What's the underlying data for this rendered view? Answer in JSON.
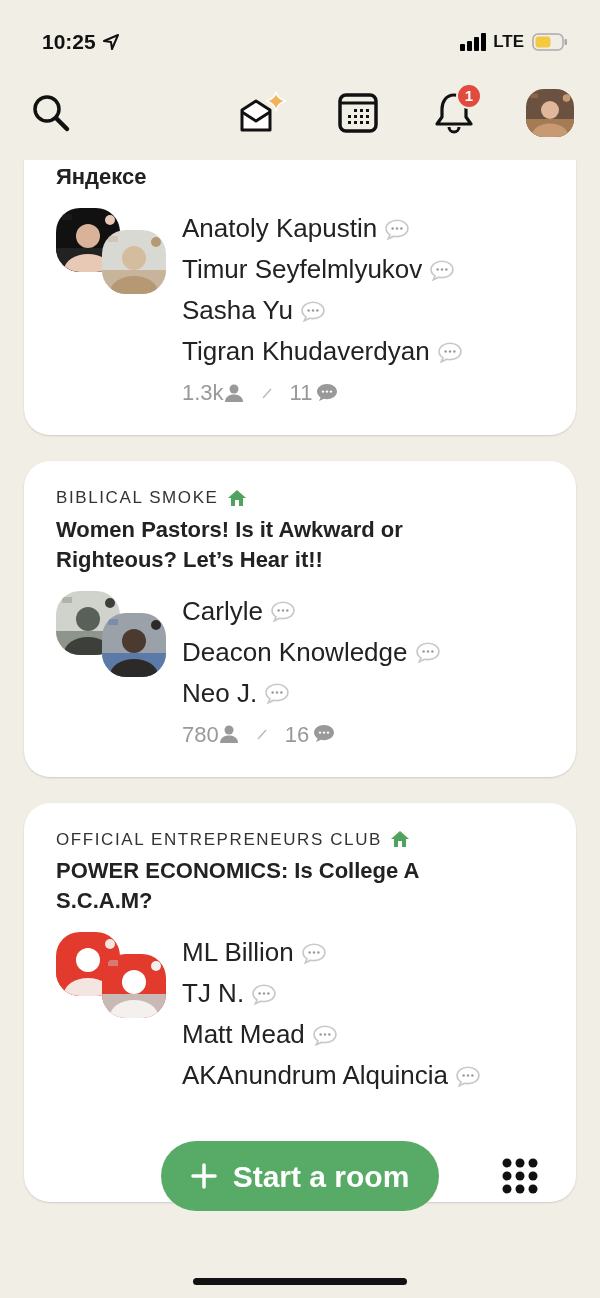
{
  "status_bar": {
    "time": "10:25",
    "network": "LTE"
  },
  "header": {
    "notification_count": "1"
  },
  "rooms": [
    {
      "title": "Яндексе",
      "speakers": [
        {
          "name": "Anatoly Kapustin"
        },
        {
          "name": "Timur Seyfelmlyukov"
        },
        {
          "name": "Sasha Yu"
        },
        {
          "name": "Tigran Khudaverdyan"
        }
      ],
      "listeners": "1.3k",
      "comments": "11"
    },
    {
      "club": "BIBLICAL SMOKE",
      "title": "Women Pastors! Is it Awkward or Righteous? Let’s Hear it!!",
      "speakers": [
        {
          "name": "Carlyle"
        },
        {
          "name": "Deacon Knowledge"
        },
        {
          "name": "Neo J."
        }
      ],
      "listeners": "780",
      "comments": "16"
    },
    {
      "club": "OFFICIAL ENTREPRENEURS CLUB",
      "title": "POWER ECONOMICS: Is College A S.C.A.M?",
      "speakers": [
        {
          "name": "ML Billion"
        },
        {
          "name": "TJ N."
        },
        {
          "name": "Matt Mead"
        },
        {
          "name": "AKAnundrum Alquincia"
        }
      ]
    }
  ],
  "start_button": {
    "label": "Start a room"
  }
}
